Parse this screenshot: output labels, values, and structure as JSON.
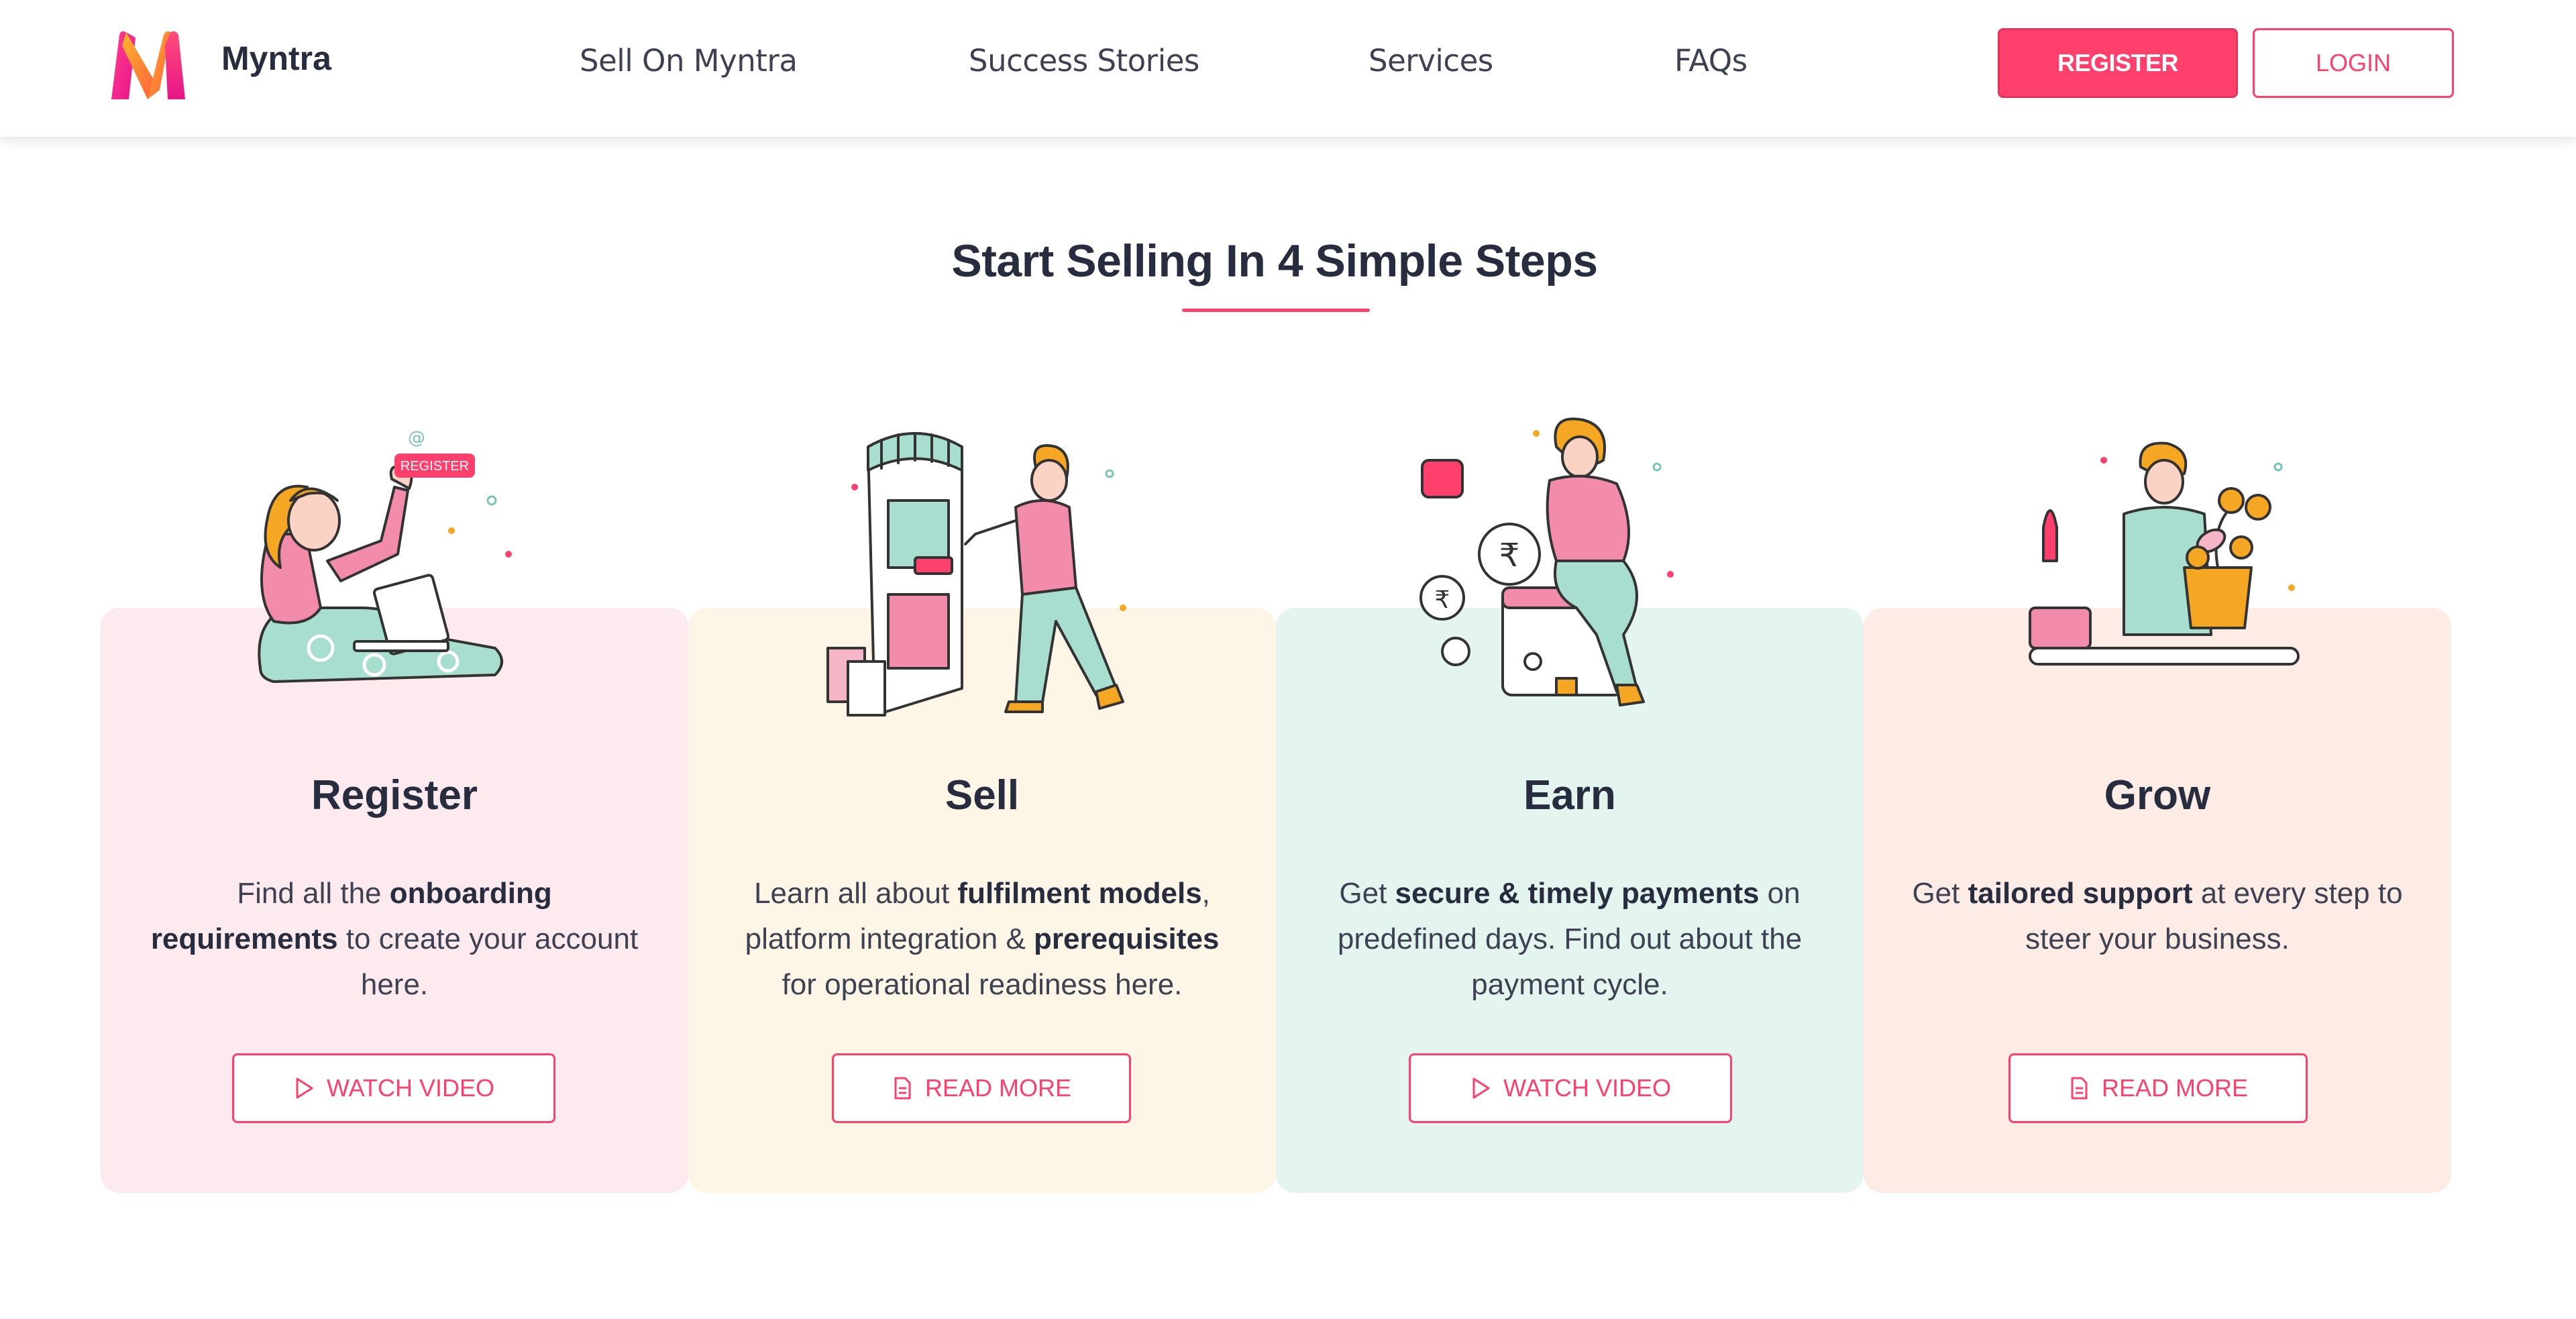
{
  "header": {
    "brand": "Myntra",
    "nav": [
      "Sell On Myntra",
      "Success Stories",
      "Services",
      "FAQs"
    ],
    "register_label": "REGISTER",
    "login_label": "LOGIN"
  },
  "section": {
    "title": "Start Selling In 4 Simple Steps"
  },
  "steps": [
    {
      "title": "Register",
      "desc_parts": [
        "Find all the ",
        "onboarding requirements",
        " to create your account here."
      ],
      "button_label": "WATCH VIDEO",
      "button_icon": "play-icon",
      "illustration": "woman-with-laptop-register"
    },
    {
      "title": "Sell",
      "desc_parts": [
        "Learn all about ",
        "fulfilment models",
        ", platform integration & ",
        "prerequisites",
        " for operational readiness here."
      ],
      "button_label": "READ MORE",
      "button_icon": "document-icon",
      "illustration": "man-at-storefront"
    },
    {
      "title": "Earn",
      "desc_parts": [
        "Get ",
        "secure & timely payments",
        " on predefined days. Find out about the payment cycle."
      ],
      "button_label": "WATCH VIDEO",
      "button_icon": "play-icon",
      "illustration": "woman-with-wallet-and-coins"
    },
    {
      "title": "Grow",
      "desc_parts": [
        "Get ",
        "tailored support",
        " at every step to steer your business."
      ],
      "button_label": "READ MORE",
      "button_icon": "document-icon",
      "illustration": "man-with-money-plant"
    }
  ],
  "colors": {
    "accent": "#ff3f6c",
    "card_register": "#fdeaee",
    "card_sell": "#fdf5e5",
    "card_earn": "#e3f5ee",
    "card_grow": "#fcece5"
  }
}
